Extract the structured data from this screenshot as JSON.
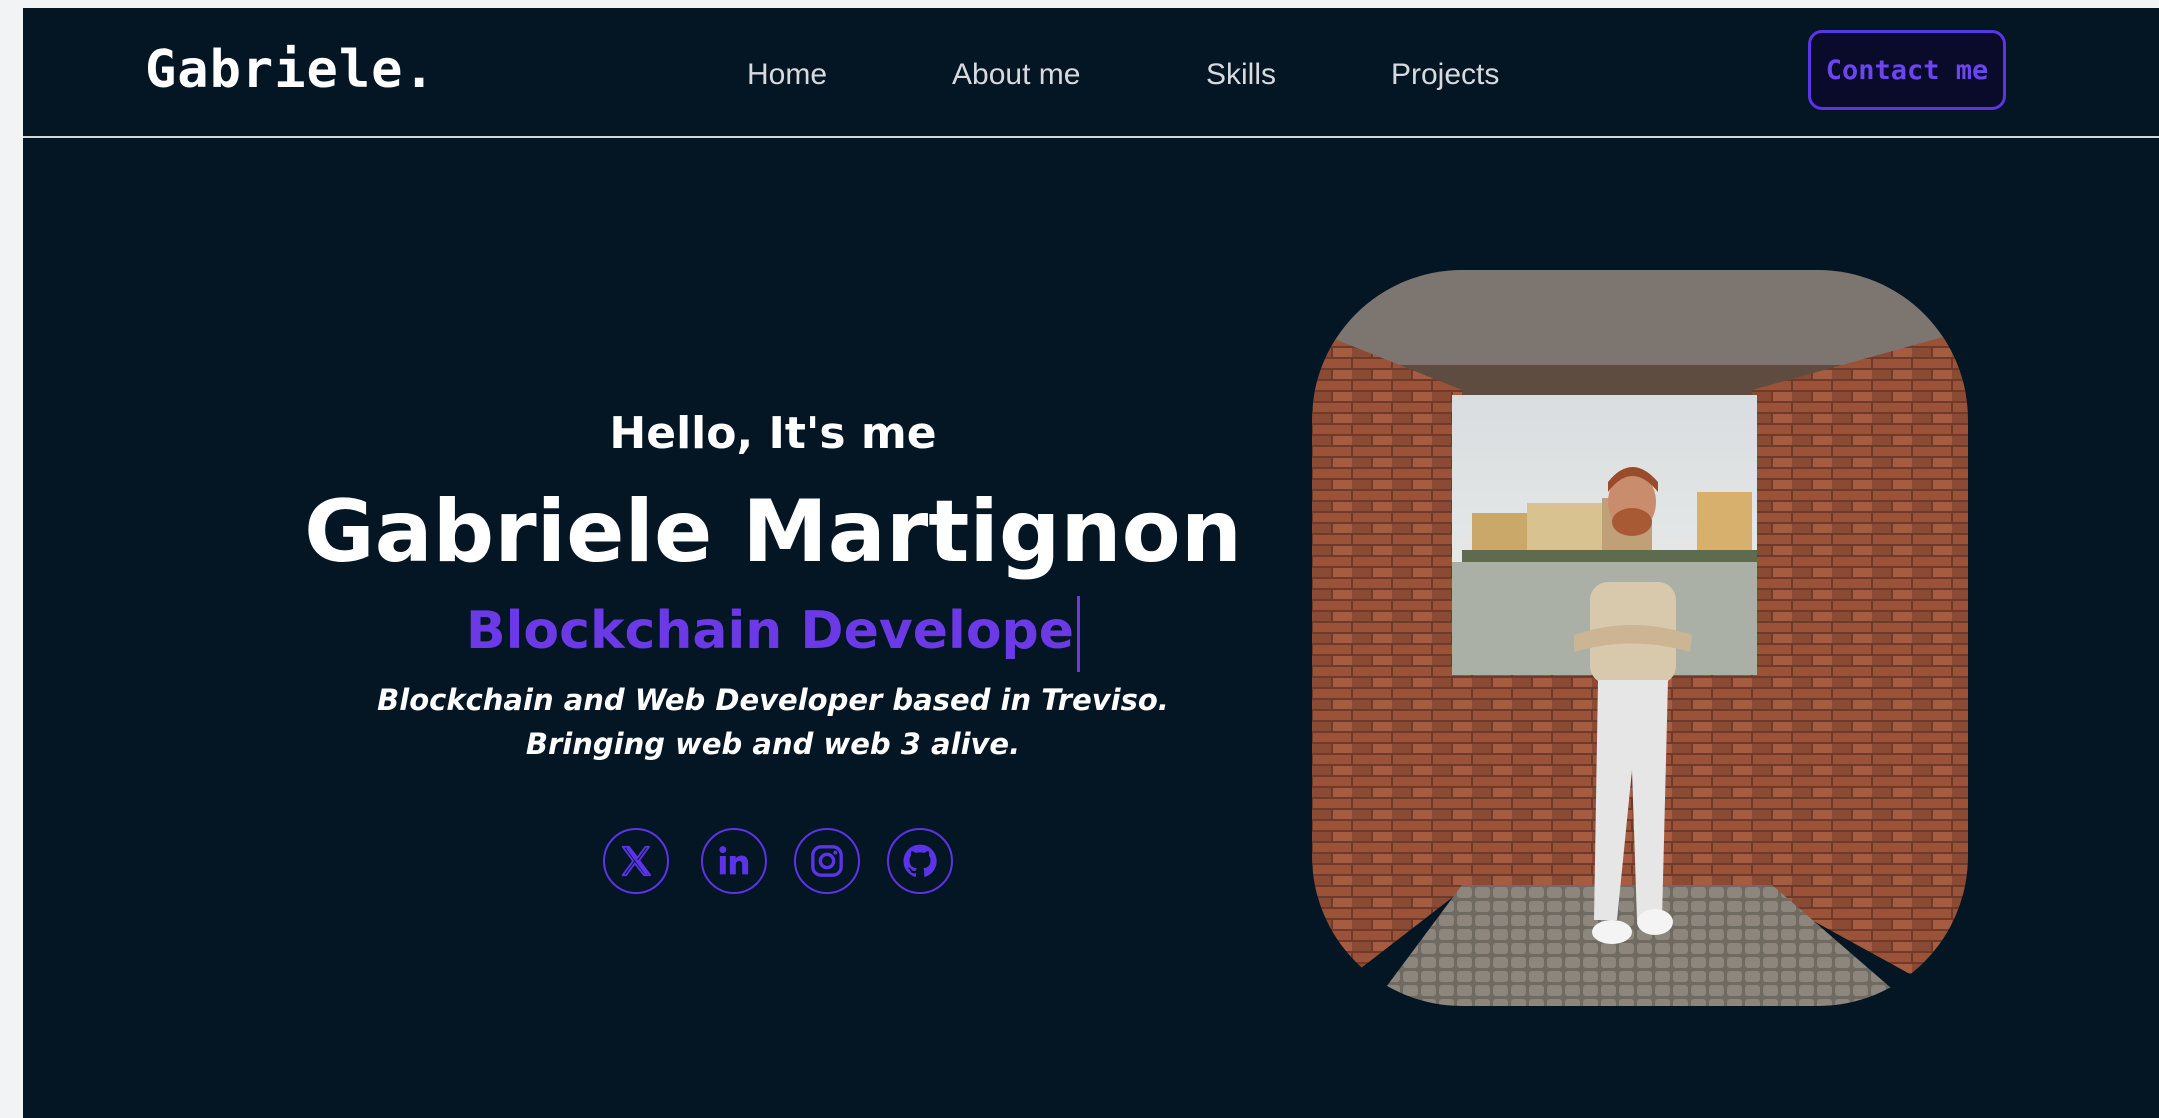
{
  "header": {
    "logo": "Gabriele.",
    "nav": [
      {
        "label": "Home"
      },
      {
        "label": "About me"
      },
      {
        "label": "Skills"
      },
      {
        "label": "Projects"
      }
    ],
    "contact_label": "Contact me"
  },
  "hero": {
    "greeting": "Hello, It's me",
    "name": "Gabriele Martignon",
    "role": "Blockchain Develope",
    "description_line1": "Blockchain and Web Developer based in Treviso.",
    "description_line2": "Bringing web and web 3 alive.",
    "socials": [
      {
        "icon": "x-icon"
      },
      {
        "icon": "linkedin-icon"
      },
      {
        "icon": "instagram-icon"
      },
      {
        "icon": "github-icon"
      }
    ]
  },
  "colors": {
    "background": "#041523",
    "accent": "#5b34e8",
    "role_text": "#6b39e6",
    "text": "#ffffff"
  }
}
